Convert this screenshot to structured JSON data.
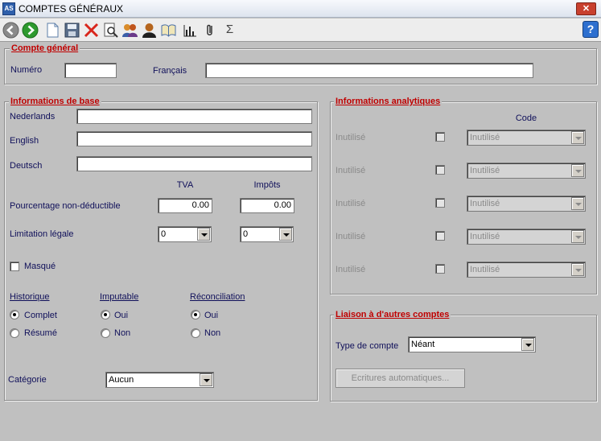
{
  "window": {
    "title": "COMPTES GÉNÉRAUX",
    "app_icon_text": "AS",
    "close_label": "✕",
    "help_label": "?"
  },
  "toolbar": {
    "icons": [
      "back-icon",
      "forward-icon",
      "new-document-icon",
      "save-icon",
      "delete-icon",
      "preview-icon",
      "users-icon",
      "user-icon",
      "book-icon",
      "chart-icon",
      "attachment-icon",
      "sum-icon"
    ],
    "sum_glyph": "Σ"
  },
  "compte_general": {
    "legend": "Compte général",
    "numero_label": "Numéro",
    "numero_value": "",
    "francais_label": "Français",
    "francais_value": ""
  },
  "base": {
    "legend": "Informations de base",
    "nederlands_label": "Nederlands",
    "nederlands_value": "",
    "english_label": "English",
    "english_value": "",
    "deutsch_label": "Deutsch",
    "deutsch_value": "",
    "tva_header": "TVA",
    "impots_header": "Impôts",
    "pourcentage_label": "Pourcentage non-déductible",
    "pourcentage_tva": "0.00",
    "pourcentage_impots": "0.00",
    "limitation_label": "Limitation légale",
    "limitation_tva": "0",
    "limitation_impots": "0",
    "masque_label": "Masqué",
    "historique_label": "Historique",
    "historique_opt1": "Complet",
    "historique_opt2": "Résumé",
    "imputable_label": "Imputable",
    "imputable_opt1": "Oui",
    "imputable_opt2": "Non",
    "reconciliation_label": "Réconciliation",
    "reconciliation_opt1": "Oui",
    "reconciliation_opt2": "Non",
    "categorie_label": "Catégorie",
    "categorie_value": "Aucun"
  },
  "analytiques": {
    "legend": "Informations analytiques",
    "code_header": "Code",
    "rows": [
      {
        "label": "Inutilisé",
        "value": "Inutilisé"
      },
      {
        "label": "Inutilisé",
        "value": "Inutilisé"
      },
      {
        "label": "Inutilisé",
        "value": "Inutilisé"
      },
      {
        "label": "Inutilisé",
        "value": "Inutilisé"
      },
      {
        "label": "Inutilisé",
        "value": "Inutilisé"
      }
    ]
  },
  "liaison": {
    "legend": "Liaison à d'autres comptes",
    "type_label": "Type de compte",
    "type_value": "Néant",
    "ecritures_label": "Ecritures automatiques..."
  },
  "colors": {
    "legend": "#c00000",
    "label": "#10105a",
    "background": "#c0c0c0"
  }
}
